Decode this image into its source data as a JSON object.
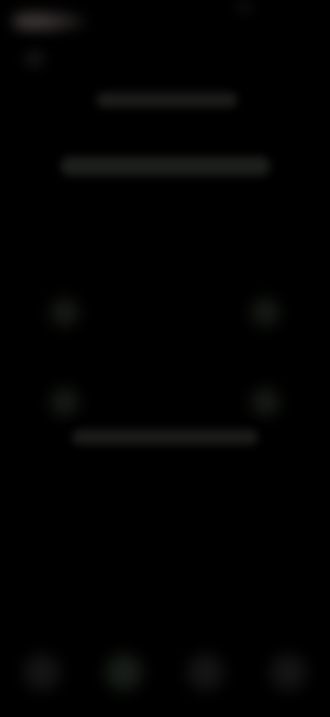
{
  "header": {
    "logo_icon": "app-logo-icon",
    "menu_icon": "menu-icon"
  },
  "main": {
    "title": "",
    "subtitle": "",
    "scanner": {
      "corner_color": "#1a1f18"
    },
    "hint": ""
  },
  "bottom_nav": {
    "items": [
      {
        "icon": "home-icon",
        "label": "",
        "active": false
      },
      {
        "icon": "scan-icon",
        "label": "",
        "active": true
      },
      {
        "icon": "history-icon",
        "label": "",
        "active": false
      },
      {
        "icon": "profile-icon",
        "label": "",
        "active": false
      }
    ]
  },
  "colors": {
    "background": "#000000",
    "accent_dim": "#1e261d"
  }
}
